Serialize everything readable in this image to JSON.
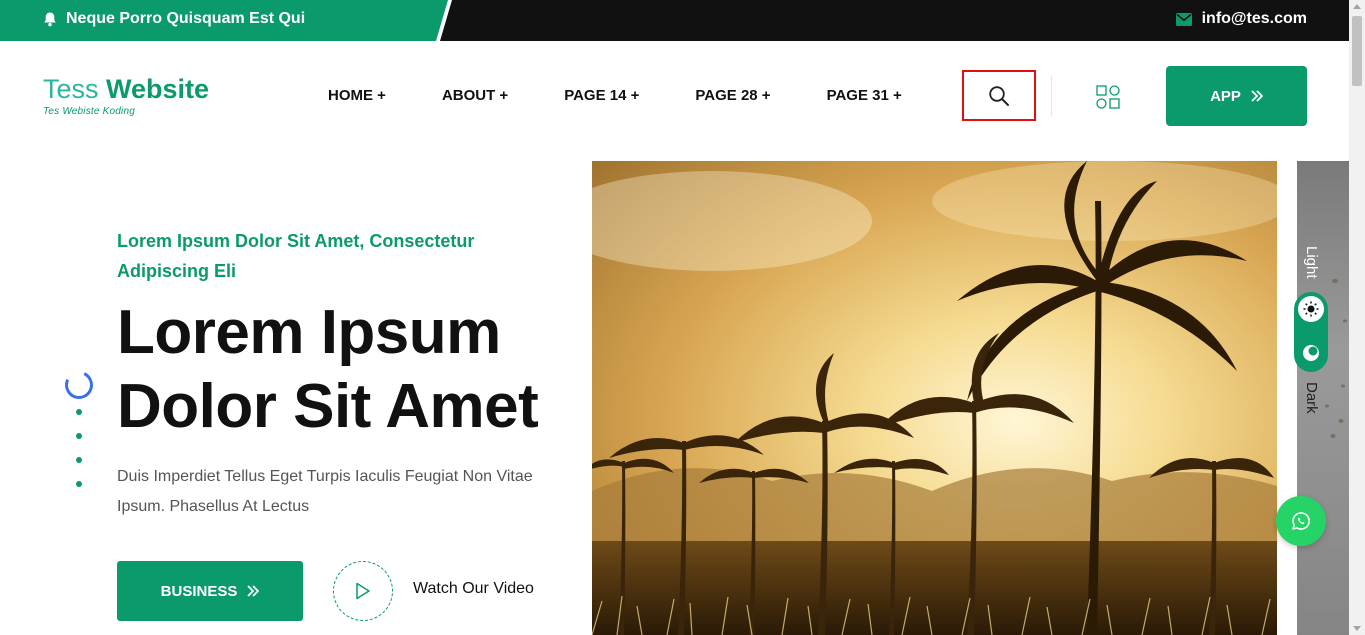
{
  "topbar": {
    "notice": "Neque Porro Quisquam Est Qui",
    "email": "info@tes.com",
    "icons": {
      "bell": "bell-icon",
      "mail": "envelope-icon"
    }
  },
  "logo": {
    "word1": "Tess ",
    "word2": "Website",
    "tagline": "Tes Webiste Koding"
  },
  "nav": {
    "items": [
      {
        "label": "HOME +"
      },
      {
        "label": "ABOUT +"
      },
      {
        "label": "PAGE 14 +"
      },
      {
        "label": "PAGE 28 +"
      },
      {
        "label": "PAGE 31 +"
      }
    ]
  },
  "header": {
    "app_label": "APP",
    "icons": {
      "search": "search-icon",
      "grid": "grid-menu-icon",
      "chevron": "double-chevron-right-icon"
    }
  },
  "hero": {
    "subtitle": "Lorem Ipsum Dolor Sit Amet, Consectetur Adipiscing Eli",
    "title": "Lorem Ipsum Dolor Sit Amet",
    "description": "Duis Imperdiet Tellus Eget Turpis Iaculis Feugiat Non Vitae Ipsum. Phasellus At Lectus",
    "business_label": "BUSINESS",
    "watch_label": "Watch Our Video",
    "slide_count": 5,
    "active_slide": 1
  },
  "theme_switch": {
    "light_label": "Light",
    "dark_label": "Dark",
    "selected": "Light"
  },
  "colors": {
    "brand": "#0b9a6c",
    "topbar_dark": "#111111",
    "whatsapp": "#25d366",
    "search_highlight": "#e01010",
    "pager_active": "#3a6ff0"
  }
}
